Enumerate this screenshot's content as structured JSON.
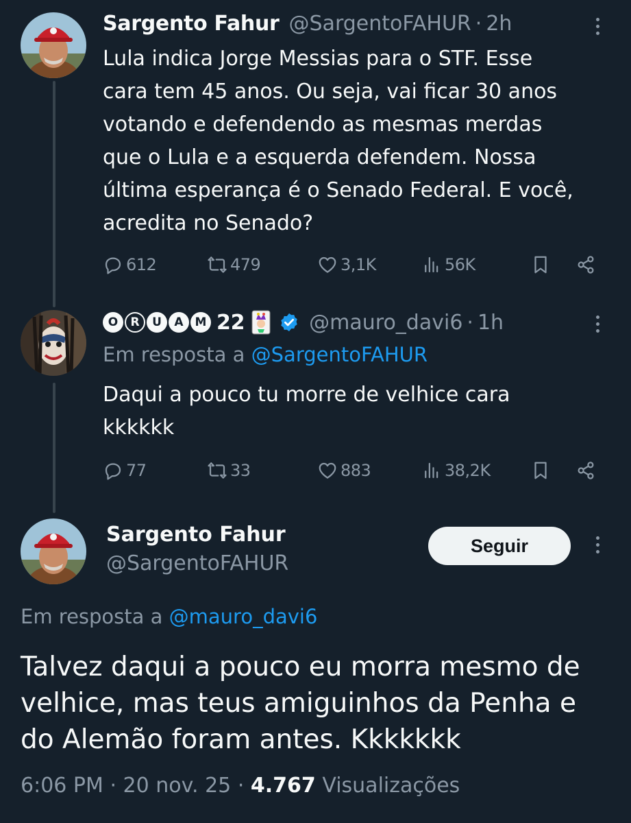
{
  "tweets": [
    {
      "author_name": "Sargento Fahur",
      "author_handle": "@SargentoFAHUR",
      "time": "2h",
      "text": "Lula indica Jorge Messias para o STF. Esse\ncara tem 45 anos. Ou seja, vai ficar 30 anos\nvotando e defendendo as mesmas merdas\nque o Lula e a esquerda defendem. Nossa\núltima esperança é o Senado Federal. E você,\nacredita no Senado?",
      "replies": "612",
      "retweets": "479",
      "likes": "3,1K",
      "views": "56K"
    },
    {
      "author_name_letters": [
        "O",
        "R",
        "U",
        "A",
        "M"
      ],
      "author_name_suffix": "22",
      "author_handle": "@mauro_davi6",
      "time": "1h",
      "reply_prefix": "Em resposta a",
      "reply_to": "@SargentoFAHUR",
      "text": "Daqui a pouco tu morre de velhice cara\nkkkkkk",
      "replies": "77",
      "retweets": "33",
      "likes": "883",
      "views": "38,2K"
    }
  ],
  "main_tweet": {
    "author_name": "Sargento Fahur",
    "author_handle": "@SargentoFAHUR",
    "follow_label": "Seguir",
    "reply_prefix": "Em resposta a",
    "reply_to": "@mauro_davi6",
    "text": "Talvez daqui a pouco eu morra mesmo de\nvelhice, mas teus amiguinhos da Penha e\ndo Alemão foram antes. Kkkkkkk",
    "time": "6:06 PM",
    "date": "20 nov. 25",
    "views_count": "4.767",
    "views_label": "Visualizações"
  },
  "colors": {
    "background": "#15202b",
    "text": "#f7f9f9",
    "secondary": "#8b98a5",
    "link": "#1d9bf0",
    "verified": "#1d9bf0"
  },
  "icons": [
    "reply-icon",
    "retweet-icon",
    "like-icon",
    "views-icon",
    "bookmark-icon",
    "share-icon",
    "more-icon",
    "verified-badge-icon",
    "joker-card-icon"
  ]
}
